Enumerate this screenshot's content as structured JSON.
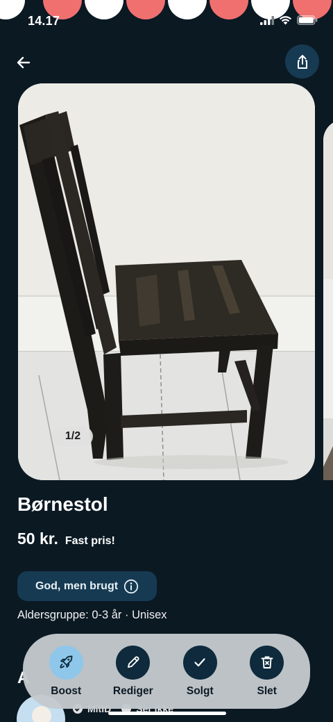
{
  "status_bar": {
    "time": "14.17"
  },
  "listing": {
    "photo_counter": "1/2",
    "title": "Børnestol",
    "price": "50 kr.",
    "price_note": "Fast pris!",
    "condition": "God, men brugt",
    "details": "Aldersgruppe: 0-3 år · Unisex"
  },
  "seller": {
    "partial_heading": "A",
    "tags": [
      "MitID",
      "Ser ikke"
    ]
  },
  "action_bar": {
    "items": [
      {
        "label": "Boost",
        "icon": "rocket-icon"
      },
      {
        "label": "Rediger",
        "icon": "pencil-icon"
      },
      {
        "label": "Solgt",
        "icon": "check-icon"
      },
      {
        "label": "Slet",
        "icon": "trash-icon"
      }
    ]
  },
  "colors": {
    "background": "#0b1923",
    "accent_dark": "#163a52",
    "boost_active": "#8ec7ea",
    "action_bar": "#c4c9cd"
  }
}
